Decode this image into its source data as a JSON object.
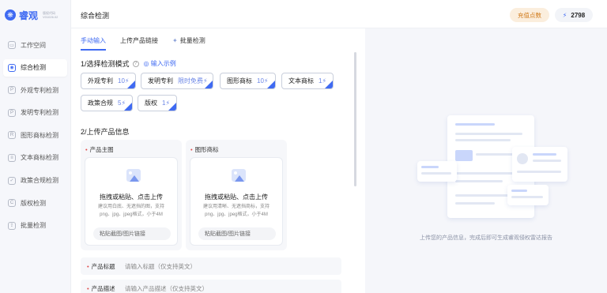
{
  "brand": {
    "name": "睿观",
    "sub_line1": "版权代码",
    "sub_line2": "V01026.02"
  },
  "sidebar": {
    "items": [
      {
        "label": "工作空间",
        "icon": "workspace-icon",
        "glyph": "▭"
      },
      {
        "label": "综合检测",
        "icon": "target-icon",
        "glyph": "◉"
      },
      {
        "label": "外观专利检测",
        "icon": "design-patent-icon",
        "glyph": "P"
      },
      {
        "label": "发明专利检测",
        "icon": "invention-patent-icon",
        "glyph": "P"
      },
      {
        "label": "图形商标检测",
        "icon": "graphic-trademark-icon",
        "glyph": "R"
      },
      {
        "label": "文本商标检测",
        "icon": "text-trademark-icon",
        "glyph": "≡"
      },
      {
        "label": "政策合规检测",
        "icon": "compliance-icon",
        "glyph": "✓"
      },
      {
        "label": "版权检测",
        "icon": "copyright-icon",
        "glyph": "C"
      },
      {
        "label": "批量检测",
        "icon": "batch-icon",
        "glyph": "⇪"
      }
    ],
    "active_index": 1
  },
  "header": {
    "title": "综合检测",
    "recharge_label": "充值点数",
    "points_value": "2798",
    "bolt": "⚡"
  },
  "tabs": [
    {
      "label": "手动输入",
      "active": true
    },
    {
      "label": "上传产品链接",
      "active": false
    },
    {
      "label": "批量检测",
      "active": false,
      "icon": "✦"
    }
  ],
  "section1": {
    "title": "1/选择检测模式",
    "info": "?",
    "example_link": "输入示例"
  },
  "modes": [
    {
      "label": "外观专利",
      "count": "10⚡"
    },
    {
      "label": "发明专利",
      "count": "限时免费⚡"
    },
    {
      "label": "图形商标",
      "count": "10⚡"
    },
    {
      "label": "文本商标",
      "count": "1⚡"
    },
    {
      "label": "政策合规",
      "count": "5⚡"
    },
    {
      "label": "版权",
      "count": "1⚡"
    }
  ],
  "section2": {
    "title": "2/上传产品信息"
  },
  "uploads": [
    {
      "label": "产品主图",
      "title": "拖拽或粘贴、点击上传",
      "tip1": "建议用白底、无遮挡的图，支持",
      "tip2": "png、jpg、jpeg格式，小于4M",
      "paste": "粘贴截图/图片链接"
    },
    {
      "label": "图形商标",
      "title": "拖拽或粘贴、点击上传",
      "tip1": "建议用清晰、无遮挡商标，支持",
      "tip2": "png、jpg、jpeg格式，小于4M",
      "paste": "粘贴截图/图片链接"
    }
  ],
  "fields": [
    {
      "label": "产品标题",
      "placeholder": "请输入标题（仅支持英文）"
    },
    {
      "label": "产品描述",
      "placeholder": "请输入产品描述（仅支持英文）"
    }
  ],
  "right_panel": {
    "caption": "上传您的产品信息，完成后即可生成睿观侵权雷达报告"
  }
}
